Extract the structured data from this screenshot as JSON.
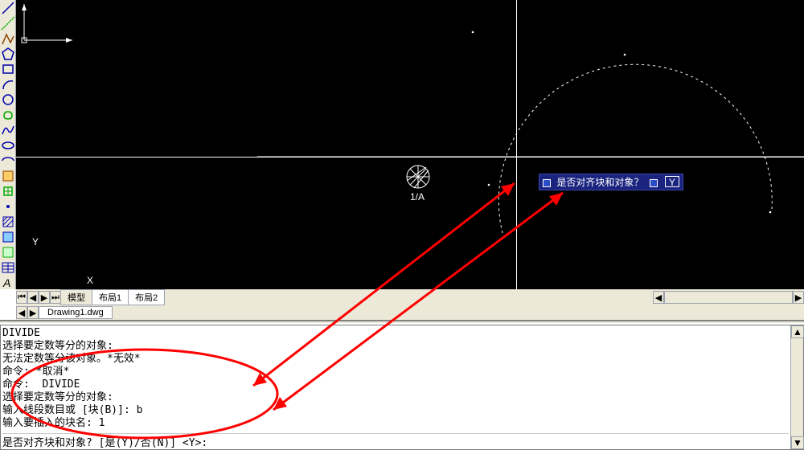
{
  "tabs": {
    "model": "模型",
    "layout1": "布局1",
    "layout2": "布局2"
  },
  "file": {
    "name": "Drawing1.dwg"
  },
  "canvas": {
    "marker_label": "1/A",
    "axis_x": "X",
    "axis_y": "Y"
  },
  "tooltip": {
    "text": "是否对齐块和对象？",
    "value": "Y"
  },
  "command": {
    "lines": [
      "DIVIDE",
      "选择要定数等分的对象:",
      "无法定数等分该对象。*无效*",
      "命令: *取消*",
      "命令:  DIVIDE",
      "选择要定数等分的对象:",
      "输入线段数目或 [块(B)]: b",
      "输入要插入的块名: 1",
      ""
    ],
    "prompt": "是否对齐块和对象? [是(Y)/否(N)] <Y>:"
  }
}
